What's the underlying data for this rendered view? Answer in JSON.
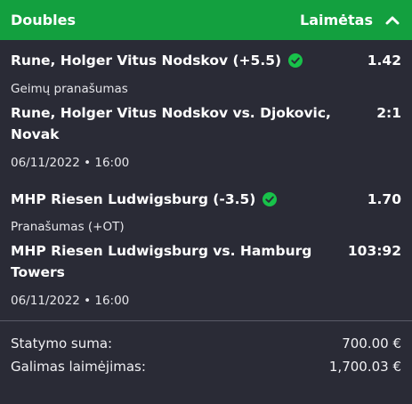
{
  "header": {
    "title": "Doubles",
    "status": "Laimėtas",
    "chevron_icon": "chevron-up-icon"
  },
  "bets": [
    {
      "selection": "Rune, Holger Vitus Nodskov (+5.5)",
      "odds": "1.42",
      "market": "Geimų pranašumas",
      "event": "Rune, Holger Vitus Nodskov vs. Djokovic, Novak",
      "score": "2:1",
      "datetime": "06/11/2022 • 16:00",
      "status_icon": "check-circle-icon"
    },
    {
      "selection": "MHP Riesen Ludwigsburg (-3.5)",
      "odds": "1.70",
      "market": "Pranašumas (+OT)",
      "event": "MHP Riesen Ludwigsburg vs. Hamburg Towers",
      "score": "103:92",
      "datetime": "06/11/2022 • 16:00",
      "status_icon": "check-circle-icon"
    }
  ],
  "summary": {
    "stake_label": "Statymo suma:",
    "stake_value": "700.00 €",
    "winnings_label": "Galimas laimėjimas:",
    "winnings_value": "1,700.03 €"
  },
  "colors": {
    "accent": "#13a03f",
    "background": "#2a2b36",
    "check": "#18c24a"
  }
}
